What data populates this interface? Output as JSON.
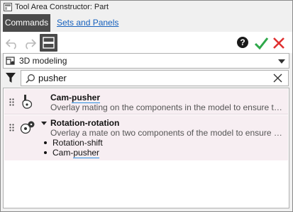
{
  "window": {
    "title": "Tool Area Constructor: Part"
  },
  "tabs": {
    "active": "Commands",
    "other": "Sets and Panels"
  },
  "toolbar": {
    "help_label": "?"
  },
  "category": {
    "selected": "3D modeling"
  },
  "search": {
    "value": "pusher",
    "placeholder": ""
  },
  "results": [
    {
      "title_pre": "Cam-",
      "title_hl": "pusher",
      "title_post": "",
      "description": "Overlay mating on the components in the model to ensure the relative movement of the cam and the pusher"
    },
    {
      "title_pre": "Rotation-rotation",
      "title_hl": "",
      "title_post": "",
      "description": "Overlay a mate on two components of the model to ensure rotation of one component depending on the other",
      "children": [
        {
          "pre": "Rotation-shift",
          "hl": ""
        },
        {
          "pre": "Cam-",
          "hl": "pusher"
        }
      ]
    }
  ],
  "colors": {
    "accent_dark": "#4a4a4a",
    "link": "#1560bd",
    "ok_green": "#2ea84a",
    "cancel_red": "#e03030",
    "row_bg": "#f7eef2",
    "highlight_underline": "#2a8de0"
  }
}
